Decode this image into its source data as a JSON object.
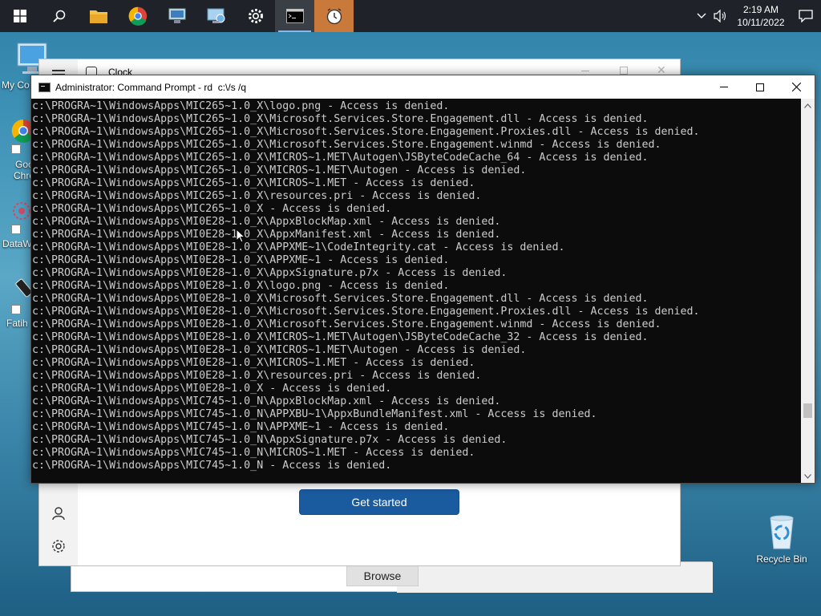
{
  "taskbar": {
    "apps": [
      "start",
      "search",
      "file-explorer",
      "chrome",
      "network-admin",
      "network-tool",
      "settings",
      "command-prompt",
      "clock"
    ],
    "time": "2:19 AM",
    "date": "10/11/2022"
  },
  "desktop": {
    "left_labels": [
      "My Co",
      "Goo",
      "Chro",
      "DataW",
      "Fatih"
    ],
    "recycle_bin": "Recycle Bin"
  },
  "clock_window": {
    "title": "Clock",
    "get_started": "Get started"
  },
  "file_window": {
    "browse": "Browse"
  },
  "cmd": {
    "title": "Administrator: Command Prompt - rd  c:\\/s /q",
    "lines": [
      "c:\\PROGRA~1\\WindowsApps\\MIC265~1.0_X\\logo.png - Access is denied.",
      "c:\\PROGRA~1\\WindowsApps\\MIC265~1.0_X\\Microsoft.Services.Store.Engagement.dll - Access is denied.",
      "c:\\PROGRA~1\\WindowsApps\\MIC265~1.0_X\\Microsoft.Services.Store.Engagement.Proxies.dll - Access is denied.",
      "c:\\PROGRA~1\\WindowsApps\\MIC265~1.0_X\\Microsoft.Services.Store.Engagement.winmd - Access is denied.",
      "c:\\PROGRA~1\\WindowsApps\\MIC265~1.0_X\\MICROS~1.MET\\Autogen\\JSByteCodeCache_64 - Access is denied.",
      "c:\\PROGRA~1\\WindowsApps\\MIC265~1.0_X\\MICROS~1.MET\\Autogen - Access is denied.",
      "c:\\PROGRA~1\\WindowsApps\\MIC265~1.0_X\\MICROS~1.MET - Access is denied.",
      "c:\\PROGRA~1\\WindowsApps\\MIC265~1.0_X\\resources.pri - Access is denied.",
      "c:\\PROGRA~1\\WindowsApps\\MIC265~1.0_X - Access is denied.",
      "c:\\PROGRA~1\\WindowsApps\\MI0E28~1.0_X\\AppxBlockMap.xml - Access is denied.",
      "c:\\PROGRA~1\\WindowsApps\\MI0E28~1.0_X\\AppxManifest.xml - Access is denied.",
      "c:\\PROGRA~1\\WindowsApps\\MI0E28~1.0_X\\APPXME~1\\CodeIntegrity.cat - Access is denied.",
      "c:\\PROGRA~1\\WindowsApps\\MI0E28~1.0_X\\APPXME~1 - Access is denied.",
      "c:\\PROGRA~1\\WindowsApps\\MI0E28~1.0_X\\AppxSignature.p7x - Access is denied.",
      "c:\\PROGRA~1\\WindowsApps\\MI0E28~1.0_X\\logo.png - Access is denied.",
      "c:\\PROGRA~1\\WindowsApps\\MI0E28~1.0_X\\Microsoft.Services.Store.Engagement.dll - Access is denied.",
      "c:\\PROGRA~1\\WindowsApps\\MI0E28~1.0_X\\Microsoft.Services.Store.Engagement.Proxies.dll - Access is denied.",
      "c:\\PROGRA~1\\WindowsApps\\MI0E28~1.0_X\\Microsoft.Services.Store.Engagement.winmd - Access is denied.",
      "c:\\PROGRA~1\\WindowsApps\\MI0E28~1.0_X\\MICROS~1.MET\\Autogen\\JSByteCodeCache_32 - Access is denied.",
      "c:\\PROGRA~1\\WindowsApps\\MI0E28~1.0_X\\MICROS~1.MET\\Autogen - Access is denied.",
      "c:\\PROGRA~1\\WindowsApps\\MI0E28~1.0_X\\MICROS~1.MET - Access is denied.",
      "c:\\PROGRA~1\\WindowsApps\\MI0E28~1.0_X\\resources.pri - Access is denied.",
      "c:\\PROGRA~1\\WindowsApps\\MI0E28~1.0_X - Access is denied.",
      "c:\\PROGRA~1\\WindowsApps\\MIC745~1.0_N\\AppxBlockMap.xml - Access is denied.",
      "c:\\PROGRA~1\\WindowsApps\\MIC745~1.0_N\\APPXBU~1\\AppxBundleManifest.xml - Access is denied.",
      "c:\\PROGRA~1\\WindowsApps\\MIC745~1.0_N\\APPXME~1 - Access is denied.",
      "c:\\PROGRA~1\\WindowsApps\\MIC745~1.0_N\\AppxSignature.p7x - Access is denied.",
      "c:\\PROGRA~1\\WindowsApps\\MIC745~1.0_N\\MICROS~1.MET - Access is denied.",
      "c:\\PROGRA~1\\WindowsApps\\MIC745~1.0_N - Access is denied."
    ],
    "scroll_position": 0.85
  }
}
